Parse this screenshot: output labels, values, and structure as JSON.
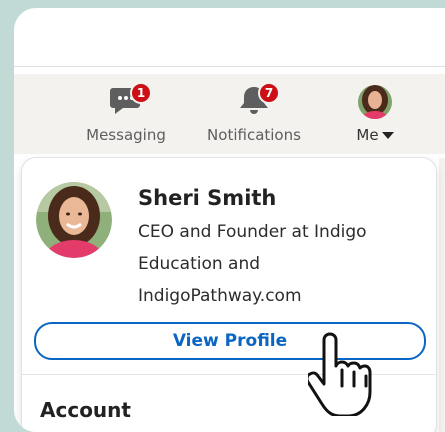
{
  "nav": {
    "items": [
      {
        "label": "Messaging",
        "icon": "messaging-icon",
        "badge": "1"
      },
      {
        "label": "Notifications",
        "icon": "bell-icon",
        "badge": "7"
      },
      {
        "label": "Me",
        "icon": "profile-avatar"
      }
    ]
  },
  "profile": {
    "name": "Sheri Smith",
    "headline_lines": [
      "CEO and Founder at Indigo",
      "Education and",
      "IndigoPathway.com"
    ],
    "view_profile_label": "View Profile"
  },
  "menu": {
    "account_label": "Account"
  },
  "colors": {
    "accent": "#0a66c2",
    "badge": "#cc1016",
    "background": "#c2dad5"
  }
}
